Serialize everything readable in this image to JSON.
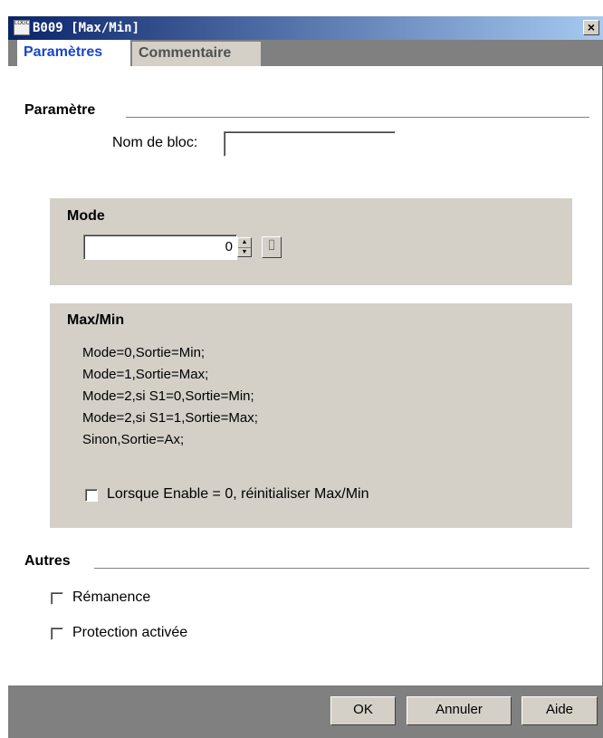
{
  "window": {
    "title": "B009 [Max/Min]",
    "app_icon_text": "LOGO",
    "close_symbol": "×"
  },
  "tabs": [
    {
      "label": "Paramètres",
      "active": true
    },
    {
      "label": "Commentaire",
      "active": false
    }
  ],
  "parametre": {
    "section_title": "Paramètre",
    "block_name_label": "Nom de bloc:",
    "block_name_value": ""
  },
  "mode": {
    "title": "Mode",
    "value": "0",
    "spin_up": "▲",
    "spin_down": "▼",
    "param_button_symbol": "⌷"
  },
  "maxmin": {
    "title": "Max/Min",
    "lines": [
      "Mode=0,Sortie=Min;",
      "Mode=1,Sortie=Max;",
      "Mode=2,si S1=0,Sortie=Min;",
      "Mode=2,si S1=1,Sortie=Max;",
      "Sinon,Sortie=Ax;"
    ],
    "reset_checkbox_label": "Lorsque Enable = 0, réinitialiser Max/Min",
    "reset_checked": false
  },
  "autres": {
    "section_title": "Autres",
    "remanence_label": "Rémanence",
    "remanence_checked": false,
    "protection_label": "Protection activée",
    "protection_checked": false
  },
  "buttons": {
    "ok": "OK",
    "cancel": "Annuler",
    "help": "Aide"
  },
  "colors": {
    "title_gradient_start": "#0a246a",
    "title_gradient_end": "#a6caf0",
    "active_tab_text": "#1846c8",
    "panel_bg": "#d4d0c8"
  }
}
